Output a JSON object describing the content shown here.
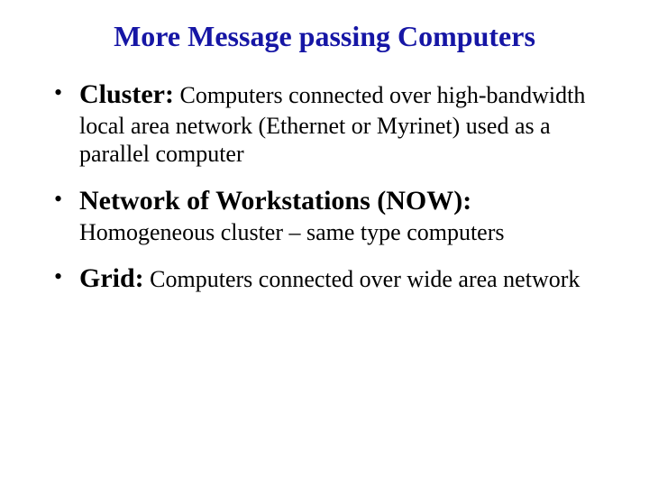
{
  "title": "More Message passing Computers",
  "items": [
    {
      "term": "Cluster:",
      "desc": " Computers connected over high-bandwidth local area network (Ethernet or Myrinet) used as a parallel computer"
    },
    {
      "term": "Network of Workstations (NOW):",
      "desc": " Homogeneous cluster – same type computers"
    },
    {
      "term": "Grid:",
      "desc": " Computers connected over wide area network"
    }
  ]
}
